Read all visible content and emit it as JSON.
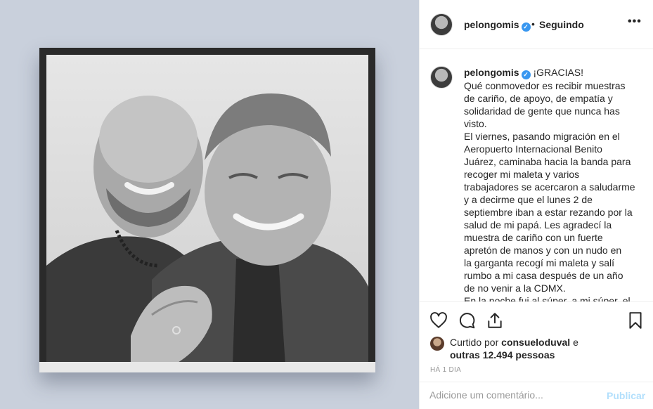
{
  "header": {
    "username": "pelongomis",
    "separator": "•",
    "follow_label": "Seguindo",
    "more_label": "•••"
  },
  "caption": {
    "username": "pelongomis",
    "lines": [
      "¡GRACIAS!",
      "Qué conmovedor es recibir muestras",
      "de cariño, de apoyo, de empatía y",
      "solidaridad de gente que nunca has",
      "visto.",
      "El viernes, pasando migración en el",
      "Aeropuerto Internacional Benito",
      "Juárez, caminaba hacia la banda para",
      "recoger mi maleta y varios",
      "trabajadores se acercaron a saludarme",
      "y a decirme que el lunes 2 de",
      "septiembre iban a estar rezando por la",
      "salud de mi papá. Les agradecí la",
      "muestra de cariño con un fuerte",
      "apretón de manos y con un nudo en",
      "la garganta recogí mi maleta y salí",
      "rumbo a mi casa después de un año",
      "de no venir a la CDMX.",
      "En la noche fui al súper, a mi súper, el"
    ]
  },
  "actions": {
    "like": "heart-icon",
    "comment": "comment-icon",
    "share": "share-icon",
    "save": "bookmark-icon"
  },
  "likes": {
    "prefix": "Curtido por ",
    "user": "consueloduval",
    "middle": " e",
    "others": "outras 12.494 pessoas"
  },
  "time_ago": "HÁ 1 DIA",
  "comment": {
    "placeholder": "Adicione um comentário...",
    "post_label": "Publicar"
  },
  "colors": {
    "verified": "#3897f0",
    "post_disabled": "#b2dffc",
    "left_background": "#c9d0dc"
  }
}
